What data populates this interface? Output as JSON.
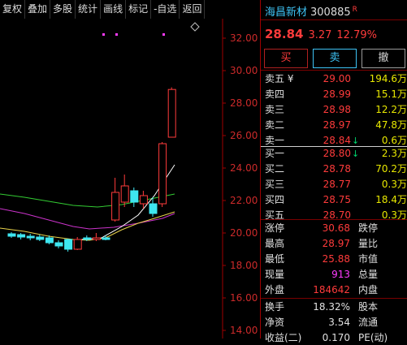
{
  "toolbar": {
    "items": [
      "复权",
      "叠加",
      "多股",
      "统计",
      "画线",
      "标记",
      "-自选",
      "返回"
    ]
  },
  "chart": {
    "y_ticks": [
      "32.00",
      "30.00",
      "28.00",
      "26.00",
      "24.00",
      "22.00",
      "20.00",
      "18.00",
      "16.00",
      "14.00"
    ],
    "diamond_icon": "diamond-icon",
    "candles": [
      {
        "o": 19.95,
        "c": 19.8,
        "h": 20.05,
        "l": 19.7
      },
      {
        "o": 19.9,
        "c": 19.75,
        "h": 20.0,
        "l": 19.6
      },
      {
        "o": 19.8,
        "c": 19.7,
        "h": 19.95,
        "l": 19.55
      },
      {
        "o": 19.75,
        "c": 19.6,
        "h": 19.9,
        "l": 19.5
      },
      {
        "o": 19.7,
        "c": 19.4,
        "h": 19.85,
        "l": 19.3
      },
      {
        "o": 19.4,
        "c": 19.2,
        "h": 19.55,
        "l": 19.05
      },
      {
        "o": 19.6,
        "c": 19.0,
        "h": 19.65,
        "l": 18.85
      },
      {
        "o": 19.0,
        "c": 19.6,
        "h": 19.75,
        "l": 18.95
      },
      {
        "o": 19.7,
        "c": 19.6,
        "h": 19.85,
        "l": 19.5
      },
      {
        "o": 19.6,
        "c": 19.7,
        "h": 20.0,
        "l": 19.5
      },
      {
        "o": 19.7,
        "c": 19.6,
        "h": 19.85,
        "l": 19.55
      },
      {
        "o": 20.8,
        "c": 22.5,
        "h": 23.4,
        "l": 20.7
      },
      {
        "o": 21.9,
        "c": 22.9,
        "h": 23.6,
        "l": 21.6
      },
      {
        "o": 22.6,
        "c": 21.9,
        "h": 22.8,
        "l": 21.6
      },
      {
        "o": 21.8,
        "c": 22.3,
        "h": 22.6,
        "l": 21.5
      },
      {
        "o": 21.8,
        "c": 21.2,
        "h": 22.2,
        "l": 21.0
      },
      {
        "o": 21.8,
        "c": 25.5,
        "h": 25.6,
        "l": 21.6
      },
      {
        "o": 25.9,
        "c": 28.84,
        "h": 28.97,
        "l": 25.88
      }
    ],
    "colors": {
      "up": "#ff3b3b",
      "down": "#3ee6f0",
      "ma_green": "#33cc33",
      "ma_purple": "#cc33cc",
      "ma_yellow": "#e8d24a",
      "ma_white": "#ffffff"
    },
    "markers": 3
  },
  "quote": {
    "name": "海昌新材",
    "code": "300885",
    "badge": "R",
    "last": "28.84",
    "change": "3.27",
    "pct": "12.79%",
    "buttons": {
      "buy": "买",
      "sell": "卖",
      "cancel": "撤"
    },
    "asks": [
      {
        "label": "卖五 ¥",
        "price": "29.00",
        "vol": "194.6万",
        "arrow": ""
      },
      {
        "label": "卖四",
        "price": "28.99",
        "vol": "15.1万",
        "arrow": ""
      },
      {
        "label": "卖三",
        "price": "28.98",
        "vol": "12.2万",
        "arrow": ""
      },
      {
        "label": "卖二",
        "price": "28.97",
        "vol": "47.8万",
        "arrow": ""
      },
      {
        "label": "卖一",
        "price": "28.84",
        "vol": "0.6万",
        "arrow": "↓"
      }
    ],
    "bids": [
      {
        "label": "买一",
        "price": "28.80",
        "vol": "2.3万",
        "arrow": "↓"
      },
      {
        "label": "买二",
        "price": "28.78",
        "vol": "70.2万",
        "arrow": ""
      },
      {
        "label": "买三",
        "price": "28.77",
        "vol": "0.3万",
        "arrow": ""
      },
      {
        "label": "买四",
        "price": "28.75",
        "vol": "18.4万",
        "arrow": ""
      },
      {
        "label": "买五",
        "price": "28.70",
        "vol": "0.3万",
        "arrow": ""
      }
    ],
    "stats": [
      {
        "label": "涨停",
        "value": "30.68",
        "label2": "跌停",
        "cls": "red"
      },
      {
        "label": "最高",
        "value": "28.97",
        "label2": "量比",
        "cls": "red"
      },
      {
        "label": "最低",
        "value": "25.88",
        "label2": "市值",
        "cls": "red"
      },
      {
        "label": "现量",
        "value": "913",
        "label2": "总量",
        "cls": "magenta"
      },
      {
        "label": "外盘",
        "value": "184642",
        "label2": "内盘",
        "cls": "red"
      }
    ],
    "stats2": [
      {
        "label": "换手",
        "value": "18.32%",
        "label2": "股本",
        "cls": "white"
      },
      {
        "label": "净资",
        "value": "3.54",
        "label2": "流通",
        "cls": "white"
      },
      {
        "label": "收益(二)",
        "value": "0.170",
        "label2": "PE(动)",
        "cls": "white"
      }
    ]
  }
}
